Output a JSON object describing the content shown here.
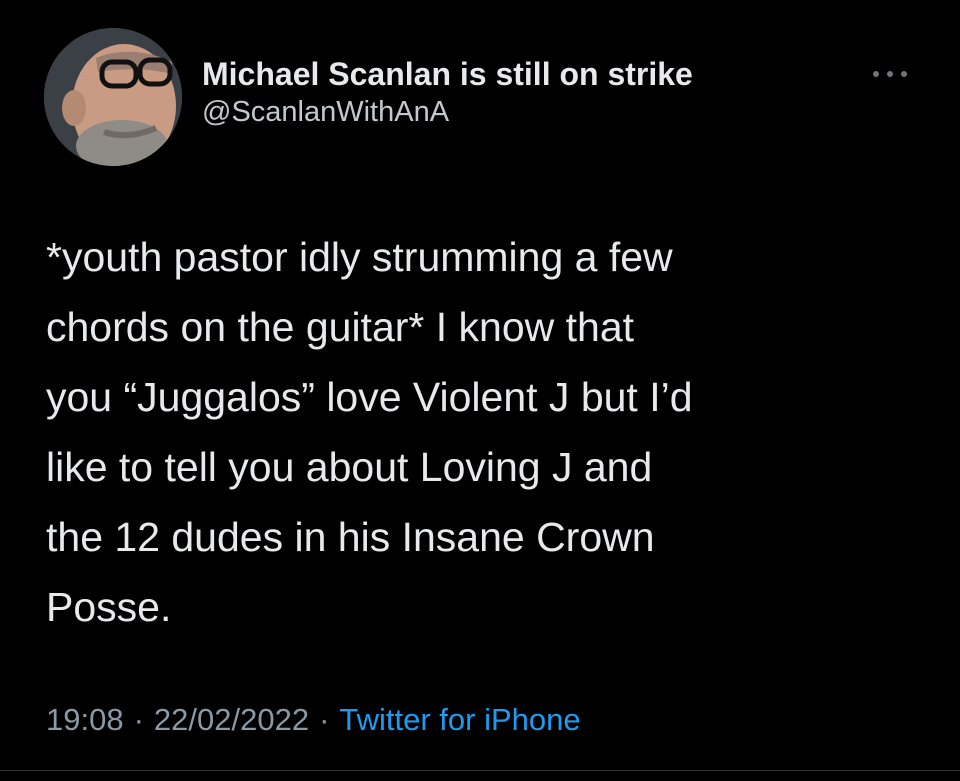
{
  "tweet": {
    "author": {
      "display_name": "Michael Scanlan is still on strike",
      "handle": "@ScanlanWithAnA",
      "avatar_icon": "profile-photo"
    },
    "more_icon": "ellipsis-icon",
    "text": "*youth pastor idly strumming a few\nchords on the guitar* I know that\nyou “Juggalos” love Violent J but I’d\nlike to tell you about Loving J and\nthe 12 dudes in his Insane Crown\nPosse.",
    "time": "19:08",
    "date": "22/02/2022",
    "separator": "·",
    "source": "Twitter for iPhone"
  },
  "colors": {
    "background": "#000000",
    "text": "#e7e9ea",
    "secondary": "#8b98a5",
    "link": "#1d9bf0"
  }
}
